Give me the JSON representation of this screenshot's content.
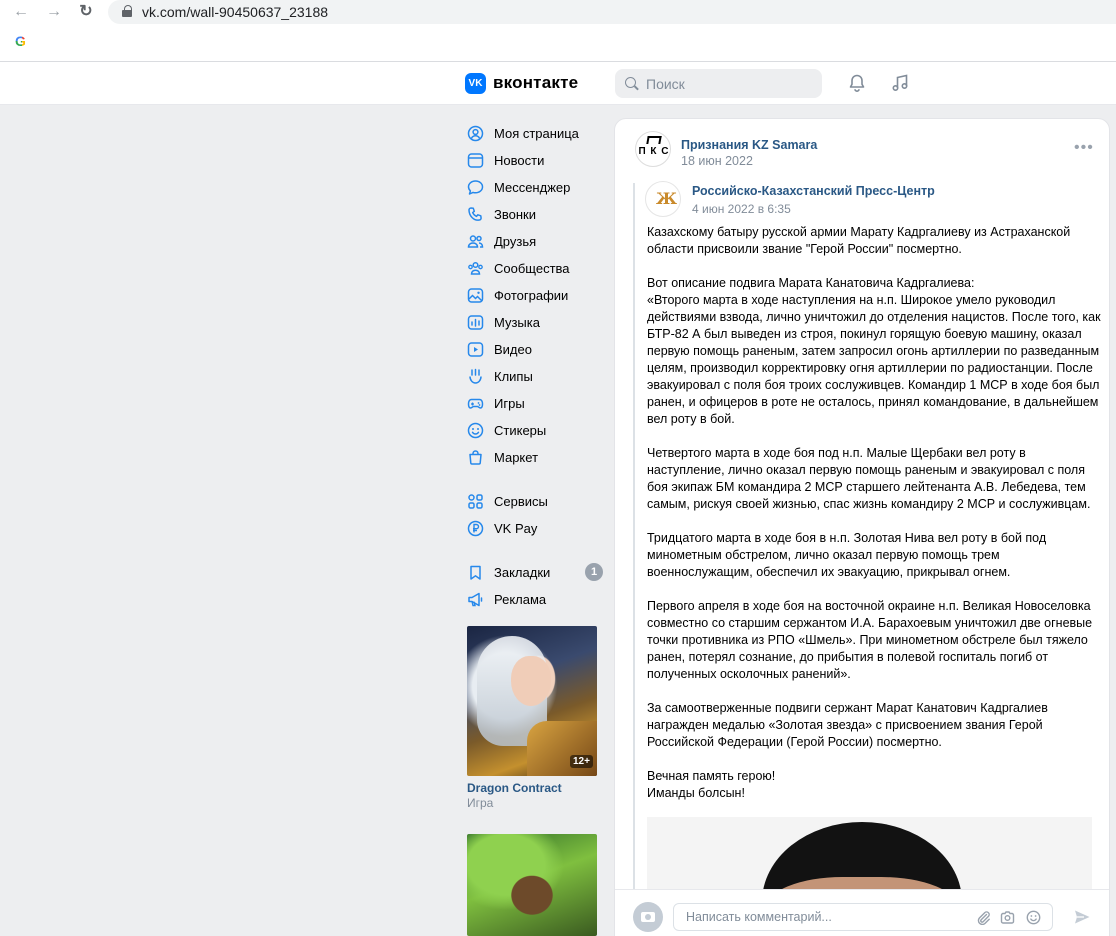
{
  "browser": {
    "url": "vk.com/wall-90450637_23188",
    "google_letter": "G"
  },
  "header": {
    "logo_text": "VK",
    "wordmark": "вконтакте",
    "search_placeholder": "Поиск"
  },
  "menu": {
    "items": [
      {
        "label": "Моя страница",
        "icon": "user-icon"
      },
      {
        "label": "Новости",
        "icon": "news-icon"
      },
      {
        "label": "Мессенджер",
        "icon": "message-icon"
      },
      {
        "label": "Звонки",
        "icon": "phone-icon"
      },
      {
        "label": "Друзья",
        "icon": "friends-icon"
      },
      {
        "label": "Сообщества",
        "icon": "communities-icon"
      },
      {
        "label": "Фотографии",
        "icon": "photo-icon"
      },
      {
        "label": "Музыка",
        "icon": "music-icon"
      },
      {
        "label": "Видео",
        "icon": "video-icon"
      },
      {
        "label": "Клипы",
        "icon": "clips-icon"
      },
      {
        "label": "Игры",
        "icon": "gamepad-icon"
      },
      {
        "label": "Стикеры",
        "icon": "sticker-icon"
      },
      {
        "label": "Маркет",
        "icon": "market-icon"
      },
      {
        "label": "Сервисы",
        "icon": "services-icon"
      },
      {
        "label": "VK Pay",
        "icon": "vkpay-icon"
      },
      {
        "label": "Закладки",
        "icon": "bookmark-icon",
        "badge": "1"
      },
      {
        "label": "Реклама",
        "icon": "megaphone-icon"
      }
    ]
  },
  "ads": {
    "first": {
      "title": "Dragon Contract",
      "subtitle": "Игра",
      "age": "12+"
    }
  },
  "post": {
    "author": "Признания KZ Samara",
    "avatar_text": "П К С",
    "date": "18 июн 2022",
    "repost": {
      "author": "Российско-Казахстанский Пресс-Центр",
      "date": "4 июн 2022 в 6:35",
      "paragraphs": [
        "Казахскому батыру русской армии Марату Кадргалиеву из Астраханской области присвоили звание \"Герой России\" посмертно.",
        "Вот описание подвига Марата Канатовича Кадргалиева:\n«Второго марта в ходе наступления на н.п. Широкое умело руководил действиями взвода, лично уничтожил до отделения нацистов. После того, как БТР-82 А был выведен из строя, покинул горящую боевую машину, оказал первую помощь раненым, затем запросил огонь артиллерии по разведанным целям, производил корректировку огня артиллерии по радиостанции. После эвакуировал с поля боя троих сослуживцев. Командир 1 МСР в ходе боя был ранен, и офицеров в роте не осталось, принял командование, в дальнейшем вел роту в бой.",
        "Четвертого марта в ходе боя под н.п. Малые Щербаки вел роту в наступление, лично оказал первую помощь раненым и эвакуировал с поля боя экипаж БМ командира 2 МСР старшего лейтенанта А.В. Лебедева, тем самым, рискуя своей жизнью, спас жизнь командиру 2 МСР и сослуживцам.",
        "Тридцатого марта в ходе боя в н.п. Золотая Нива вел роту в бой под минометным обстрелом, лично оказал первую помощь трем военнослужащим, обеспечил их эвакуацию, прикрывал огнем.",
        "Первого апреля в ходе боя на восточной окраине н.п. Великая Новоселовка совместно со старшим сержантом И.А. Барахоевым уничтожил две огневые точки противника из РПО «Шмель». При минометном обстреле был тяжело ранен, потерял сознание, до прибытия в полевой госпиталь погиб от полученных осколочных ранений».",
        "За самоотверженные подвиги сержант Марат Канатович Кадргалиев награжден медалью «Золотая звезда» с присвоением звания Герой Российской Федерации (Герой России) посмертно.",
        "Вечная память герою!\nИманды болсын!"
      ]
    },
    "comment_placeholder": "Написать комментарий..."
  }
}
